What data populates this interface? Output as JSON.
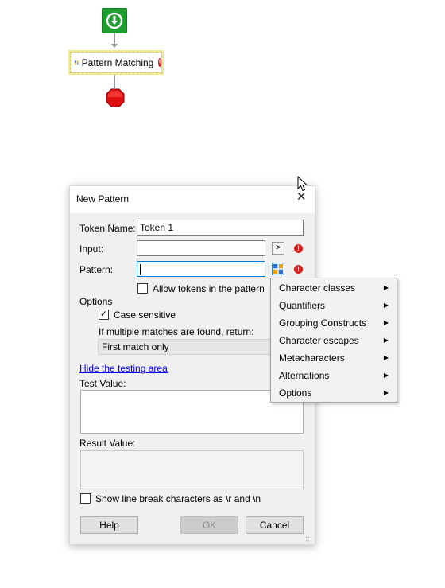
{
  "flow": {
    "step_label": "Pattern Matching",
    "error_mark": "!",
    "icons": [
      "download-arrow-icon",
      "blocks-icon",
      "error-icon",
      "stop-sign-icon"
    ]
  },
  "dialog": {
    "title": "New Pattern",
    "token_name_label": "Token Name:",
    "token_name_value": "Token 1",
    "input_label": "Input:",
    "input_value": "",
    "input_button": ">",
    "pattern_label": "Pattern:",
    "pattern_value": "",
    "allow_tokens_label": "Allow tokens in the pattern",
    "allow_tokens_checked": false,
    "options_label": "Options",
    "case_sensitive_label": "Case sensitive",
    "case_sensitive_checked": true,
    "multiple_matches_label": "If multiple matches are found, return:",
    "multiple_matches_value": "First match only",
    "hide_testing_link": "Hide the testing area",
    "test_value_label": "Test Value:",
    "result_value_label": "Result Value:",
    "line_break_label": "Show line break characters as \\r and \\n",
    "line_break_checked": false,
    "help_button": "Help",
    "ok_button": "OK",
    "cancel_button": "Cancel",
    "check_mark": "✓"
  },
  "menu": {
    "items": [
      {
        "label": "Character classes"
      },
      {
        "label": "Quantifiers"
      },
      {
        "label": "Grouping Constructs"
      },
      {
        "label": "Character escapes"
      },
      {
        "label": "Metacharacters"
      },
      {
        "label": "Alternations"
      },
      {
        "label": "Options"
      }
    ],
    "submenu_arrow": "▶"
  },
  "colors": {
    "start_green": "#1e9e2e",
    "error_red": "#d81e1e",
    "selection_yellow": "#efe79a",
    "link_blue": "#0000ee",
    "focus_blue": "#0078d7"
  }
}
